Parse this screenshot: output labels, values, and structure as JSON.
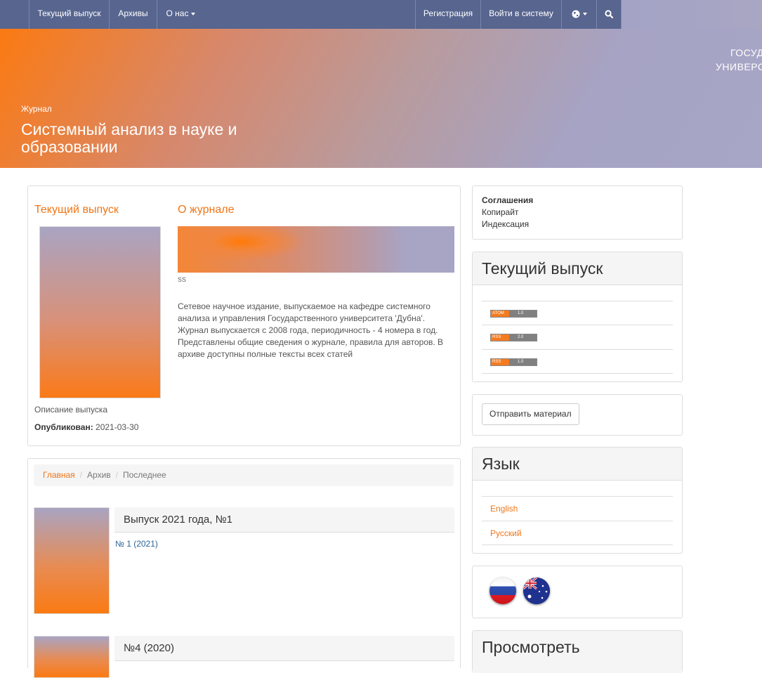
{
  "nav": {
    "current_issue": "Текущий выпуск",
    "archives": "Архивы",
    "about": "О нас",
    "register": "Регистрация",
    "login": "Войти в систему"
  },
  "banner": {
    "univ_line1": "ГОСУД",
    "univ_line2": "УНИВЕРС",
    "label": "Журнал",
    "title": "Системный анализ в науке и образовании"
  },
  "current": {
    "heading": "Текущий выпуск",
    "description_label": "Описание выпуска",
    "published_label": "Опубликован:",
    "published_date": "2021-03-30"
  },
  "about": {
    "heading": "О журнале",
    "caption": "ss",
    "text": "Сетевое научное издание, выпускаемое на кафедре системного анализа и управления Государственного университета 'Дубна'. Журнал выпускается с 2008 года, периодичность - 4 номера в год. Представлены общие сведения о журнале, правила для авторов. В архиве доступны полные тексты всех статей"
  },
  "breadcrumb": {
    "home": "Главная",
    "archive": "Архив",
    "latest": "Последнее"
  },
  "issues": [
    {
      "title": "Выпуск 2021 года, №1",
      "link": "№ 1 (2021)"
    },
    {
      "title": "№4 (2020)"
    }
  ],
  "sidebar": {
    "agreements": "Соглашения",
    "copyright": "Копирайт",
    "indexing": "Индексация",
    "current_issue_title": "Текущий выпуск",
    "feeds": [
      {
        "left": "ATOM",
        "right": "1.0"
      },
      {
        "left": "RSS",
        "right": "2.0"
      },
      {
        "left": "RSS",
        "right": "1.0"
      }
    ],
    "submit": "Отправить материал",
    "language_title": "Язык",
    "languages": [
      "English",
      "Русский"
    ],
    "browse_title": "Просмотреть"
  },
  "colors": {
    "nav": "#57658f",
    "accent": "#f07516",
    "link": "#2a6496"
  },
  "icons": {
    "globe": "globe-icon",
    "search": "search-icon"
  }
}
